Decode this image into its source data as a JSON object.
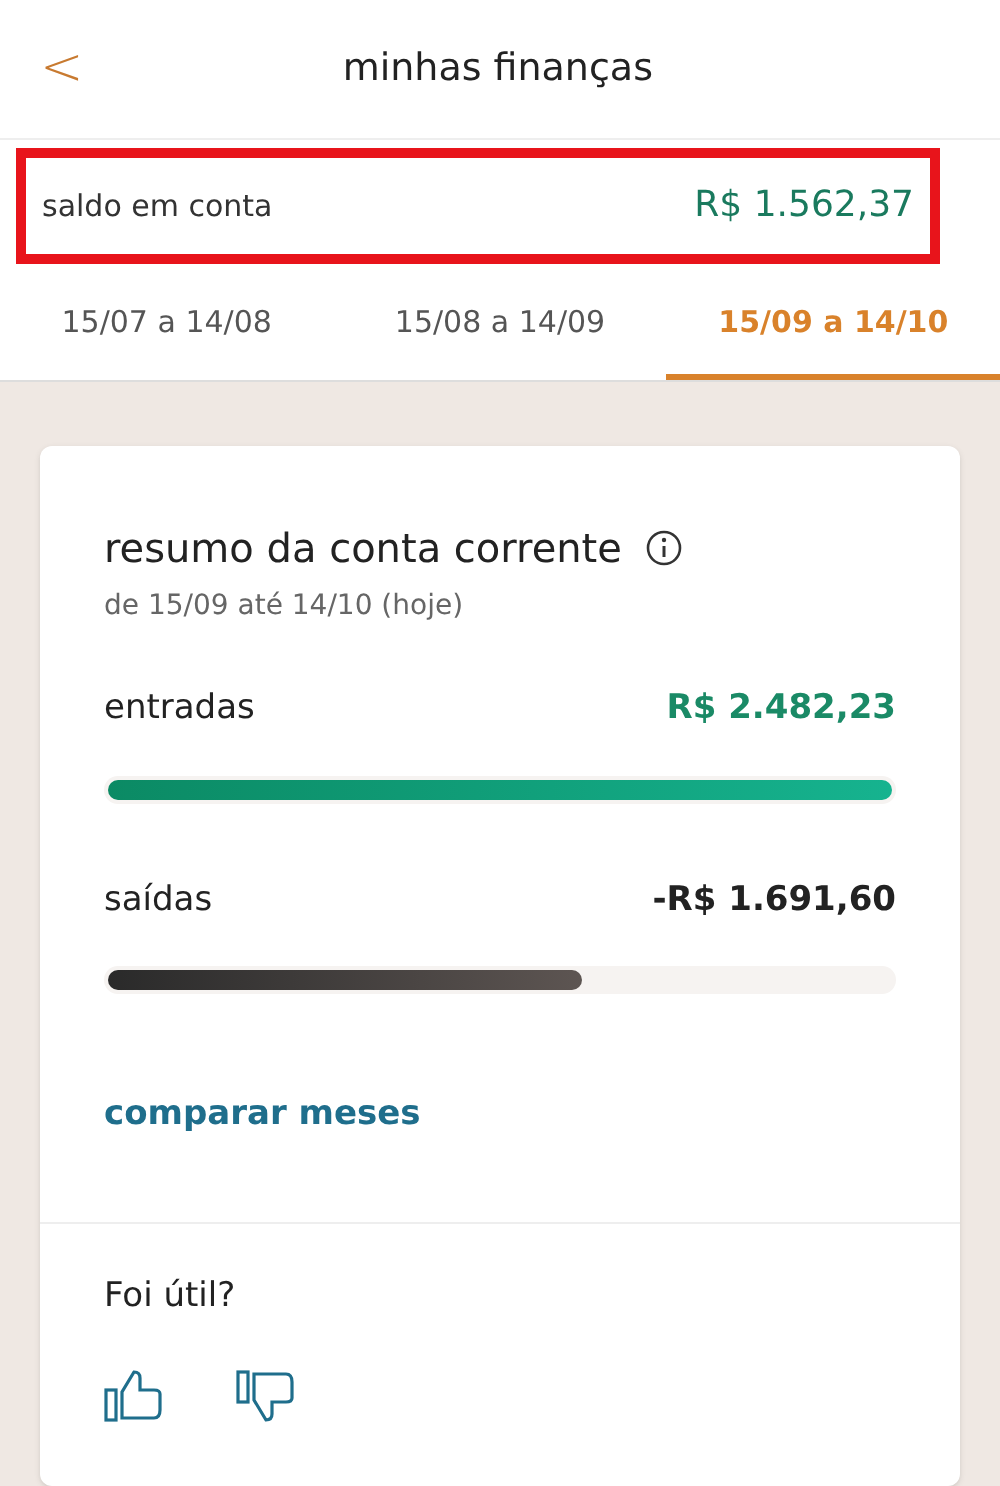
{
  "header": {
    "back": "<",
    "title": "minhas finanças"
  },
  "balance": {
    "label": "saldo em conta",
    "value": "R$ 1.562,37",
    "highlighted": true
  },
  "tabs": [
    {
      "label": "15/07 a 14/08",
      "selected": false
    },
    {
      "label": "15/08 a 14/09",
      "selected": false
    },
    {
      "label": "15/09 a 14/10",
      "selected": true
    }
  ],
  "summary": {
    "title": "resumo da conta corrente",
    "subtitle": "de 15/09 até 14/10 (hoje)",
    "rows": [
      {
        "kind": "in",
        "label": "entradas",
        "value": "R$ 2.482,23",
        "level": 1.0
      },
      {
        "kind": "out",
        "label": "saídas",
        "value": "-R$ 1.691,60",
        "level": 0.605
      }
    ],
    "link": "comparar meses"
  },
  "feedback": {
    "question": "Foi útil?"
  }
}
